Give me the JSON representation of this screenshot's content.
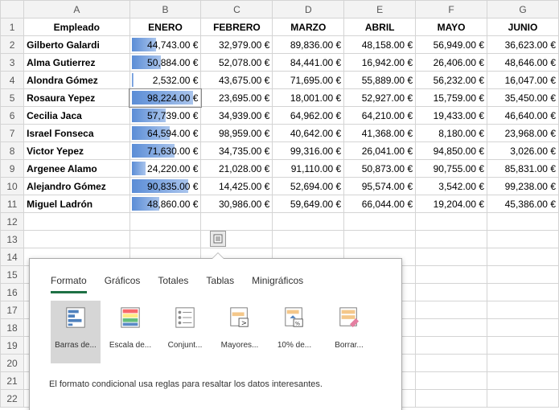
{
  "columns": [
    "A",
    "B",
    "C",
    "D",
    "E",
    "F",
    "G"
  ],
  "row_numbers": [
    "1",
    "2",
    "3",
    "4",
    "5",
    "6",
    "7",
    "8",
    "9",
    "10",
    "11",
    "12",
    "13",
    "14",
    "15",
    "16",
    "17",
    "18",
    "19",
    "20",
    "21",
    "22"
  ],
  "headers": [
    "Empleado",
    "ENERO",
    "FEBRERO",
    "MARZO",
    "ABRIL",
    "MAYO",
    "JUNIO"
  ],
  "rows": [
    {
      "name": "Gilberto Galardi",
      "enero": "44,743.00 €",
      "enero_pct": 0.4,
      "feb": "32,979.00 €",
      "mar": "89,836.00 €",
      "abr": "48,158.00 €",
      "may": "56,949.00 €",
      "jun": "36,623.00 €"
    },
    {
      "name": "Alma Gutierrez",
      "enero": "50,884.00 €",
      "enero_pct": 0.47,
      "feb": "52,078.00 €",
      "mar": "84,441.00 €",
      "abr": "16,942.00 €",
      "may": "26,406.00 €",
      "jun": "48,646.00 €"
    },
    {
      "name": "Alondra Gómez",
      "enero": "2,532.00 €",
      "enero_pct": 0.02,
      "feb": "43,675.00 €",
      "mar": "71,695.00 €",
      "abr": "55,889.00 €",
      "may": "56,232.00 €",
      "jun": "16,047.00 €"
    },
    {
      "name": "Rosaura Yepez",
      "enero": "98,224.00 €",
      "enero_pct": 1.0,
      "feb": "23,695.00 €",
      "mar": "18,001.00 €",
      "abr": "52,927.00 €",
      "may": "15,759.00 €",
      "jun": "35,450.00 €"
    },
    {
      "name": "Cecilia Jaca",
      "enero": "57,739.00 €",
      "enero_pct": 0.55,
      "feb": "34,939.00 €",
      "mar": "64,962.00 €",
      "abr": "64,210.00 €",
      "may": "19,433.00 €",
      "jun": "46,640.00 €"
    },
    {
      "name": "Israel Fonseca",
      "enero": "64,594.00 €",
      "enero_pct": 0.62,
      "feb": "98,959.00 €",
      "mar": "40,642.00 €",
      "abr": "41,368.00 €",
      "may": "8,180.00 €",
      "jun": "23,968.00 €"
    },
    {
      "name": "Victor Yepez",
      "enero": "71,630.00 €",
      "enero_pct": 0.7,
      "feb": "34,735.00 €",
      "mar": "99,316.00 €",
      "abr": "26,041.00 €",
      "may": "94,850.00 €",
      "jun": "3,026.00 €"
    },
    {
      "name": "Argenee Alamo",
      "enero": "24,220.00 €",
      "enero_pct": 0.22,
      "feb": "21,028.00 €",
      "mar": "91,110.00 €",
      "abr": "50,873.00 €",
      "may": "90,755.00 €",
      "jun": "85,831.00 €"
    },
    {
      "name": "Alejandro Gómez",
      "enero": "90,835.00 €",
      "enero_pct": 0.92,
      "feb": "14,425.00 €",
      "mar": "52,694.00 €",
      "abr": "95,574.00 €",
      "may": "3,542.00 €",
      "jun": "99,238.00 €"
    },
    {
      "name": "Miguel Ladrón",
      "enero": "48,860.00 €",
      "enero_pct": 0.45,
      "feb": "30,986.00 €",
      "mar": "59,649.00 €",
      "abr": "66,044.00 €",
      "may": "19,204.00 €",
      "jun": "45,386.00 €"
    }
  ],
  "quick_analysis": {
    "tabs": [
      "Formato",
      "Gráficos",
      "Totales",
      "Tablas",
      "Minigráficos"
    ],
    "active_tab": "Formato",
    "options": [
      {
        "label": "Barras de...",
        "icon": "data-bars-icon"
      },
      {
        "label": "Escala de...",
        "icon": "color-scale-icon"
      },
      {
        "label": "Conjunt...",
        "icon": "icon-set-icon"
      },
      {
        "label": "Mayores...",
        "icon": "greater-than-icon"
      },
      {
        "label": "10% de...",
        "icon": "top-ten-icon"
      },
      {
        "label": "Borrar...",
        "icon": "clear-format-icon"
      }
    ],
    "description": "El formato condicional usa reglas para resaltar los datos interesantes."
  },
  "colors": {
    "data_bar": "#5b8dd6",
    "active_tab_underline": "#1e7145",
    "header_bg": "#f3f3f3"
  }
}
